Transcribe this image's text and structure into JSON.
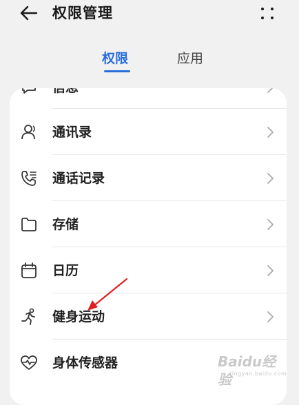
{
  "header": {
    "back_icon": "arrow-left-icon",
    "title": "权限管理",
    "more_icon": "more-dots-icon"
  },
  "tabs": [
    {
      "label": "权限",
      "active": true
    },
    {
      "label": "应用",
      "active": false
    }
  ],
  "permissions": [
    {
      "label": "信息",
      "icon": "message-icon",
      "partially_visible": true
    },
    {
      "label": "通讯录",
      "icon": "contacts-icon"
    },
    {
      "label": "通话记录",
      "icon": "call-log-icon"
    },
    {
      "label": "存储",
      "icon": "folder-icon"
    },
    {
      "label": "日历",
      "icon": "calendar-icon"
    },
    {
      "label": "健身运动",
      "icon": "running-icon"
    },
    {
      "label": "身体传感器",
      "icon": "heart-pulse-icon"
    }
  ],
  "annotation": {
    "type": "red-arrow",
    "target": "健身运动",
    "color": "#e02020"
  },
  "watermark": {
    "text": "Baidu经验",
    "subtext": "jingyan.baidu.com"
  },
  "colors": {
    "accent": "#2a6edb",
    "background": "#f1f1f1",
    "card": "#ffffff"
  }
}
